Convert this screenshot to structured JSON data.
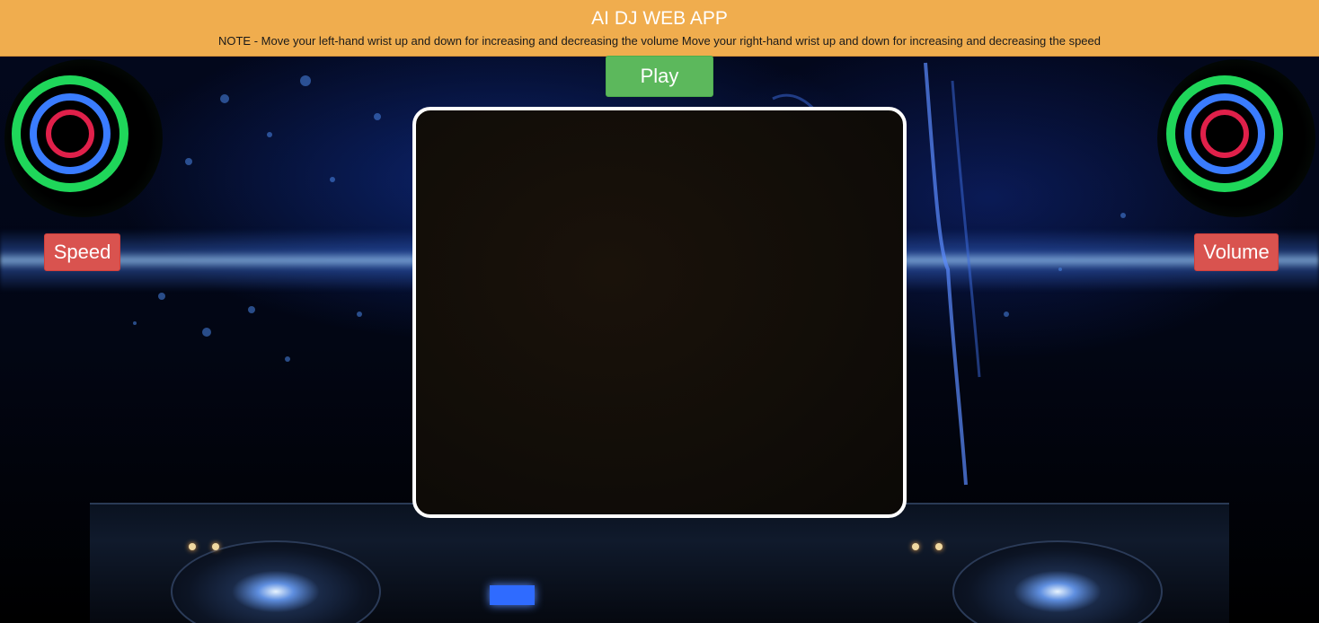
{
  "header": {
    "title": "AI DJ WEB APP",
    "note": "NOTE - Move your left-hand wrist up and down for increasing and decreasing the volume Move your right-hand wrist up and down for increasing and decreasing the speed"
  },
  "controls": {
    "play_label": "Play",
    "speed_label": "Speed",
    "volume_label": "Volume"
  },
  "colors": {
    "header_bg": "#f0ad4e",
    "play_bg": "#5cb85c",
    "label_bg": "#d9534f",
    "video_border": "#ffffff"
  },
  "icons": {
    "left_speaker": "speaker-icon",
    "right_speaker": "speaker-icon"
  }
}
